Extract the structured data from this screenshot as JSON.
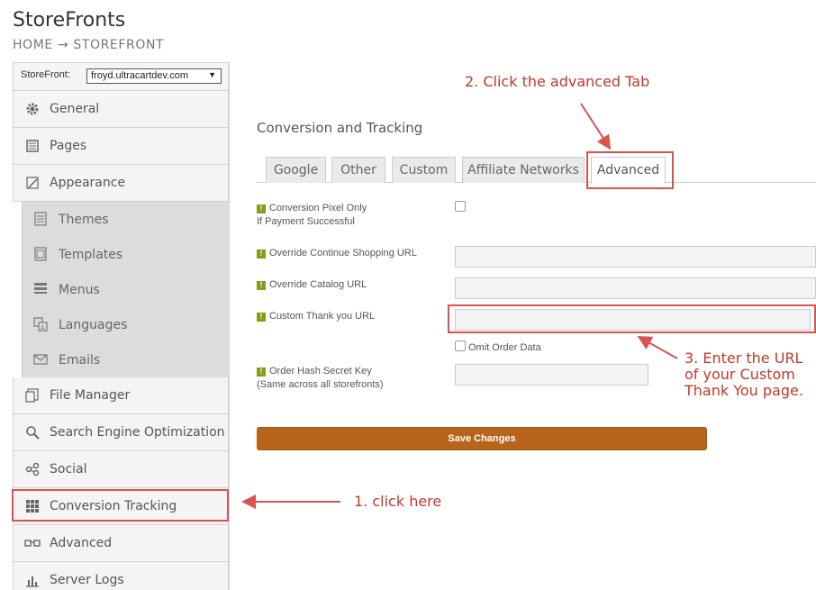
{
  "app": {
    "title": "StoreFronts"
  },
  "breadcrumb": {
    "home": "HOME",
    "separator": "→",
    "current": "STOREFRONT"
  },
  "storefront_selector": {
    "label": "StoreFront:",
    "value": "froyd.ultracartdev.com"
  },
  "sidebar": {
    "items": [
      {
        "label": "General",
        "icon": "gear-icon"
      },
      {
        "label": "Pages",
        "icon": "pages-icon"
      },
      {
        "label": "Appearance",
        "icon": "appearance-icon"
      }
    ],
    "subitems": [
      {
        "label": "Themes",
        "icon": "themes-icon"
      },
      {
        "label": "Templates",
        "icon": "templates-icon"
      },
      {
        "label": "Menus",
        "icon": "menus-icon"
      },
      {
        "label": "Languages",
        "icon": "languages-icon"
      },
      {
        "label": "Emails",
        "icon": "emails-icon"
      }
    ],
    "bottom_items": [
      {
        "label": "File Manager",
        "icon": "file-manager-icon"
      },
      {
        "label": "Search Engine Optimization",
        "icon": "search-icon"
      },
      {
        "label": "Social",
        "icon": "social-icon"
      },
      {
        "label": "Conversion Tracking",
        "icon": "grid-icon"
      },
      {
        "label": "Advanced",
        "icon": "glasses-icon"
      },
      {
        "label": "Server Logs",
        "icon": "bar-chart-icon"
      }
    ]
  },
  "main": {
    "section_title": "Conversion and Tracking",
    "tabs": [
      {
        "label": "Google"
      },
      {
        "label": "Other"
      },
      {
        "label": "Custom"
      },
      {
        "label": "Affiliate Networks"
      },
      {
        "label": "Advanced",
        "active": true
      }
    ],
    "fields": {
      "conversion_pixel": {
        "line1": "Conversion Pixel Only",
        "line2": "If Payment Successful",
        "checked": false
      },
      "continue_shopping": {
        "label": "Override Continue Shopping URL",
        "value": ""
      },
      "catalog_url": {
        "label": "Override Catalog URL",
        "value": ""
      },
      "thank_you_url": {
        "label": "Custom Thank you URL",
        "value": ""
      },
      "omit_order_data": {
        "label": "Omit Order Data",
        "checked": false
      },
      "order_hash": {
        "line1": "Order Hash Secret Key",
        "line2": "(Same across all storefronts)",
        "value": ""
      }
    },
    "save_label": "Save Changes"
  },
  "annotations": {
    "step1": "1.  click here",
    "step2": "2. Click the advanced Tab",
    "step3_line1": "3. Enter the URL",
    "step3_line2": "of your Custom",
    "step3_line3": "Thank You page."
  },
  "colors": {
    "accent": "#b8651b",
    "annotation": "#c0392b",
    "badge": "#8a9a1b"
  }
}
